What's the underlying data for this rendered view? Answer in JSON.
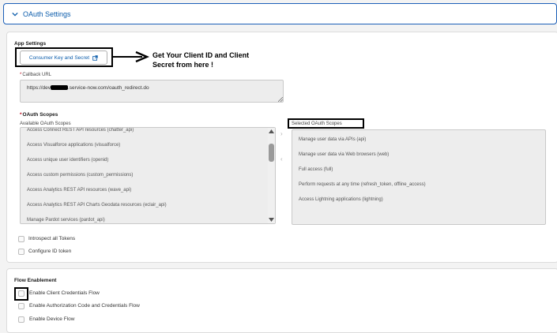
{
  "section_header": {
    "title": "OAuth Settings",
    "icon": "chevron-down-icon"
  },
  "app_settings": {
    "heading": "App Settings",
    "consumer_button_label": "Consumer Key and Secret",
    "consumer_button_icon": "external-link-icon",
    "annotation_line1": "Get Your Client ID and Client",
    "annotation_line2": "Secret from here !"
  },
  "callback": {
    "required_mark": "*",
    "label": "Callback URL",
    "value_prefix": "https://dev",
    "value_suffix": ".service-now.com/oauth_redirect.do"
  },
  "oauth_scopes": {
    "required_mark": "*",
    "label": "OAuth Scopes",
    "available_label": "Available OAuth Scopes",
    "selected_label": "Selected OAuth Scopes",
    "available": [
      "Access Connect REST API resources (chatter_api)",
      "Access Visualforce applications (visualforce)",
      "Access unique user identifiers (openid)",
      "Access custom permissions (custom_permissions)",
      "Access Analytics REST API resources (wave_api)",
      "Access Analytics REST API Charts Geodata resources (eclair_api)",
      "Manage Pardot services (pardot_api)"
    ],
    "selected": [
      "Manage user data via APIs (api)",
      "Manage user data via Web browsers (web)",
      "Full access (full)",
      "Perform requests at any time (refresh_token, offline_access)",
      "Access Lightning applications (lightning)"
    ],
    "move_right": "›",
    "move_left": "‹"
  },
  "token_options": {
    "introspect": "Introspect all Tokens",
    "id_token": "Configure ID token"
  },
  "flow": {
    "heading": "Flow Enablement",
    "client_credentials": "Enable Client Credentials Flow",
    "auth_code": "Enable Authorization Code and Credentials Flow",
    "device": "Enable Device Flow"
  }
}
